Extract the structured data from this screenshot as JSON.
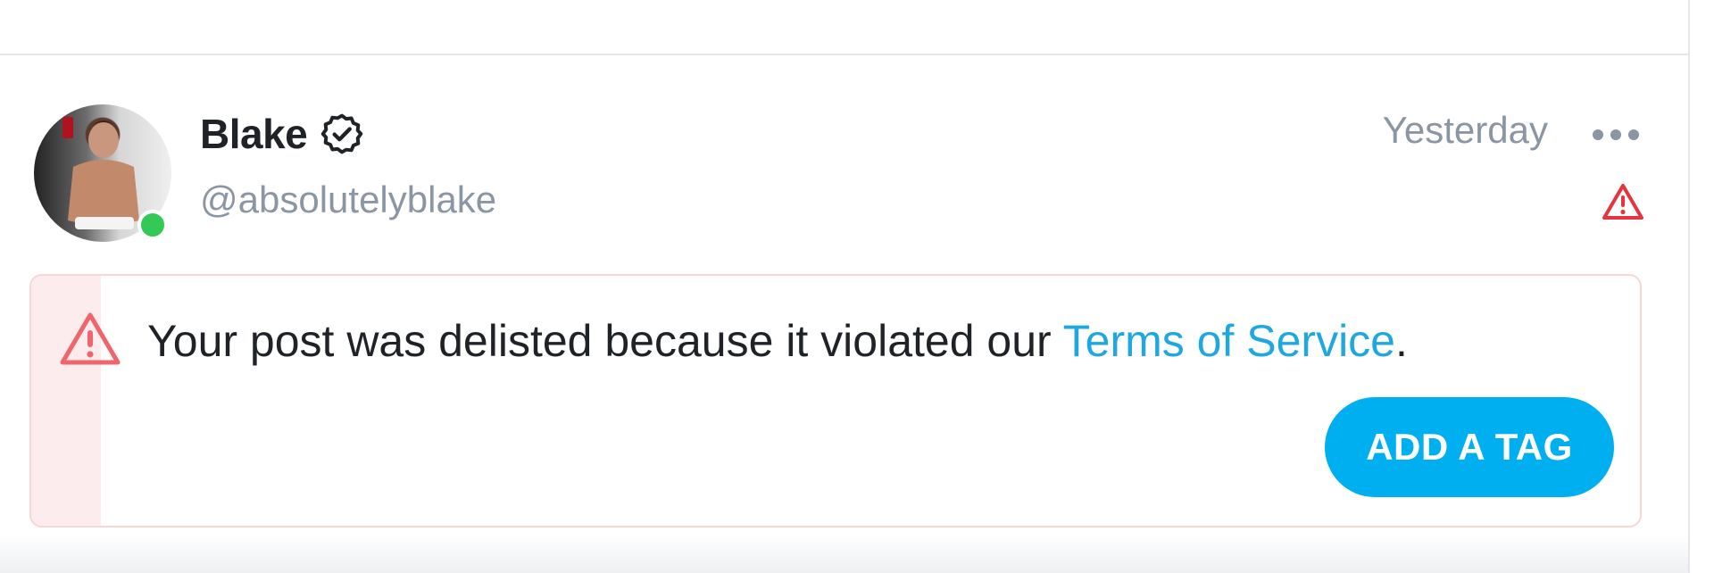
{
  "post": {
    "author": {
      "name": "Blake",
      "handle": "@absolutelyblake",
      "verified": true,
      "online": true,
      "avatar_icon": "user-avatar-photo"
    },
    "timestamp": "Yesterday",
    "menu_icon": "more-horizontal-icon",
    "status_icon": "warning-icon"
  },
  "notice": {
    "icon": "warning-triangle-icon",
    "text_before": "Your post was delisted because it violated our ",
    "link_text": "Terms of Service",
    "text_after": ".",
    "button_label": "ADD A TAG"
  },
  "colors": {
    "accent": "#00aff0",
    "link": "#1ea7e0",
    "warning": "#e5343d",
    "online": "#33c954",
    "muted_text": "#8a96a3"
  }
}
